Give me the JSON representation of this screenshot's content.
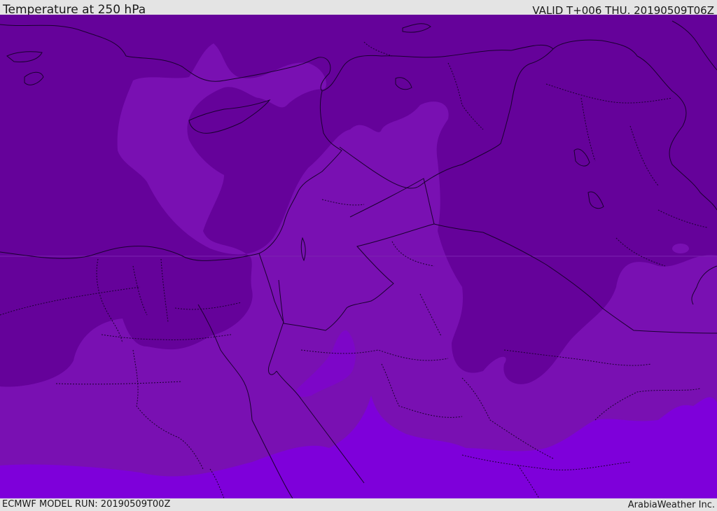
{
  "header": {
    "title": "Temperature at 250 hPa",
    "valid": "VALID T+006 THU. 20190509T06Z"
  },
  "footer": {
    "model_run": "ECMWF MODEL RUN: 20190509T00Z",
    "credit": "ArabiaWeather Inc."
  },
  "colors": {
    "band_coldest": "#65029a",
    "band_mid": "#7910b2",
    "band_warm": "#7e00da",
    "band_warm_patch": "#7d06c8",
    "boundaries": "#1a0030"
  }
}
